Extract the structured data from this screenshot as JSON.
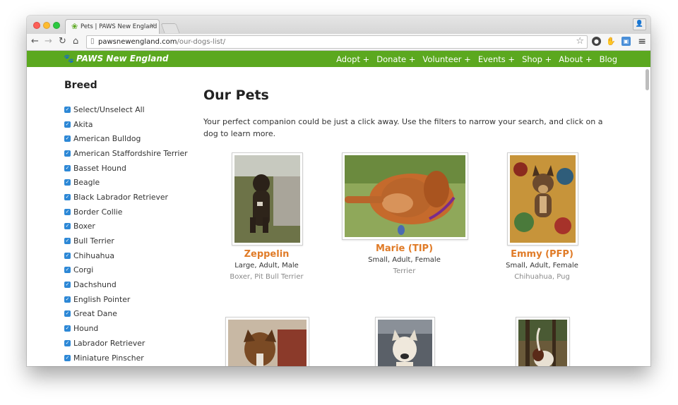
{
  "browser": {
    "tab_title": "Pets | PAWS New England",
    "url_domain": "pawsnewengland.com",
    "url_path": "/our-dogs-list/"
  },
  "site": {
    "logo_text": "PAWS New England",
    "nav": [
      "Adopt +",
      "Donate +",
      "Volunteer +",
      "Events +",
      "Shop +",
      "About +",
      "Blog"
    ],
    "brand_color": "#5ba81f",
    "accent_color": "#e07b27"
  },
  "sidebar": {
    "title": "Breed",
    "breeds": [
      "Select/Unselect All",
      "Akita",
      "American Bulldog",
      "American Staffordshire Terrier",
      "Basset Hound",
      "Beagle",
      "Black Labrador Retriever",
      "Border Collie",
      "Boxer",
      "Bull Terrier",
      "Chihuahua",
      "Corgi",
      "Dachshund",
      "English Pointer",
      "Great Dane",
      "Hound",
      "Labrador Retriever",
      "Miniature Pinscher"
    ]
  },
  "main": {
    "heading": "Our Pets",
    "intro": "Your perfect companion could be just a click away. Use the filters to narrow your search, and click on a dog to learn more.",
    "pets": [
      {
        "name": "Zeppelin",
        "desc": "Large, Adult, Male",
        "breed": "Boxer, Pit Bull Terrier"
      },
      {
        "name": "Marie (TIP)",
        "desc": "Small, Adult, Female",
        "breed": "Terrier"
      },
      {
        "name": "Emmy (PFP)",
        "desc": "Small, Adult, Female",
        "breed": "Chihuahua, Pug"
      }
    ]
  }
}
